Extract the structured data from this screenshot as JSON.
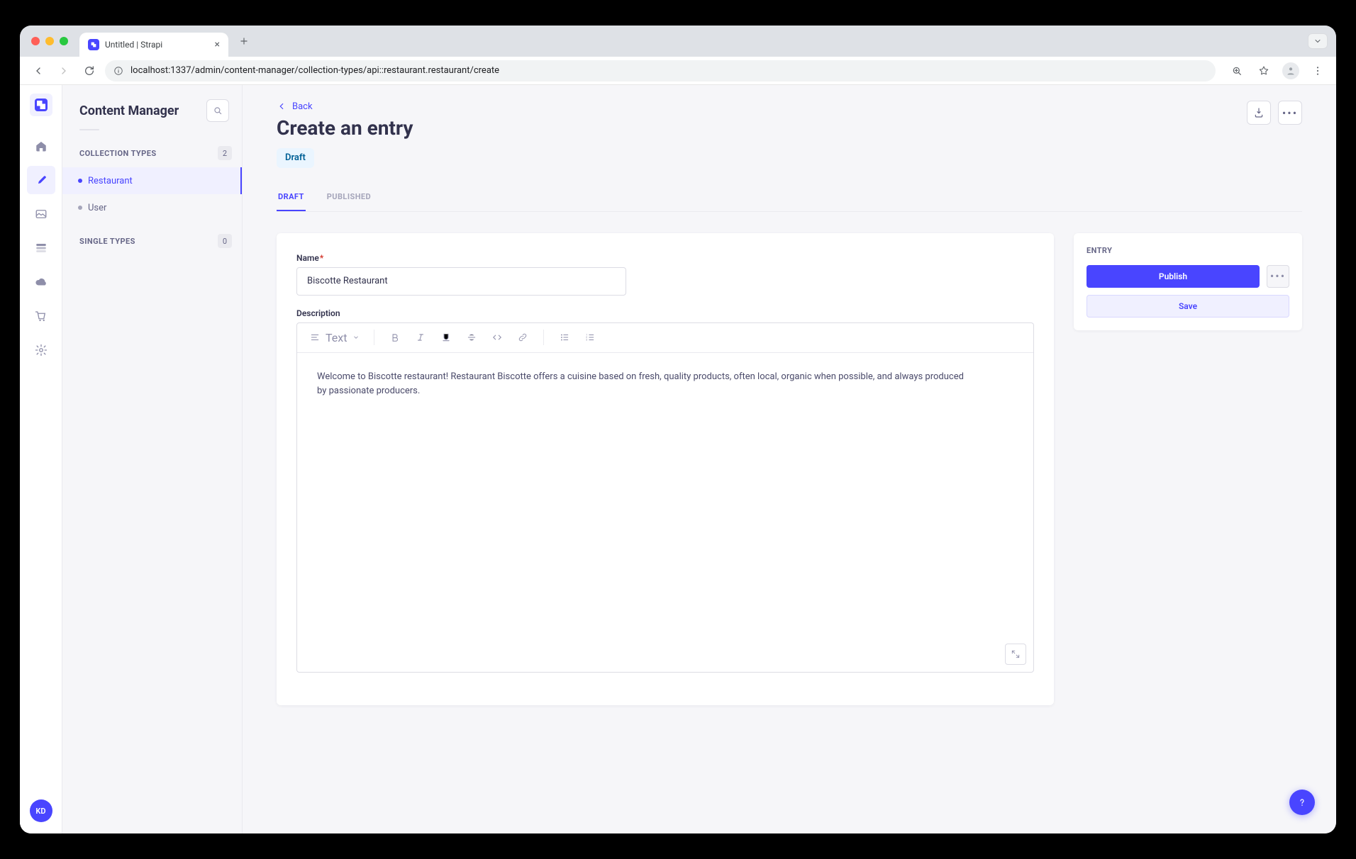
{
  "browser": {
    "tab_title": "Untitled | Strapi",
    "url": "localhost:1337/admin/content-manager/collection-types/api::restaurant.restaurant/create"
  },
  "rail": {
    "user_initials": "KD"
  },
  "sidebar": {
    "title": "Content Manager",
    "sections": [
      {
        "label": "COLLECTION TYPES",
        "count": "2",
        "items": [
          {
            "label": "Restaurant",
            "active": true
          },
          {
            "label": "User",
            "active": false
          }
        ]
      },
      {
        "label": "SINGLE TYPES",
        "count": "0",
        "items": []
      }
    ]
  },
  "page": {
    "back_label": "Back",
    "title": "Create an entry",
    "status_badge": "Draft",
    "tabs": [
      {
        "label": "DRAFT",
        "active": true
      },
      {
        "label": "PUBLISHED",
        "active": false
      }
    ]
  },
  "fields": {
    "name": {
      "label": "Name",
      "required": true,
      "value": "Biscotte Restaurant",
      "placeholder": ""
    },
    "description": {
      "label": "Description",
      "toolbar_text_label": "Text",
      "value": "Welcome to Biscotte restaurant! Restaurant Biscotte offers a cuisine based on fresh, quality products, often local, organic when possible, and always produced by passionate producers."
    }
  },
  "side_panel": {
    "title": "ENTRY",
    "publish_label": "Publish",
    "save_label": "Save"
  }
}
